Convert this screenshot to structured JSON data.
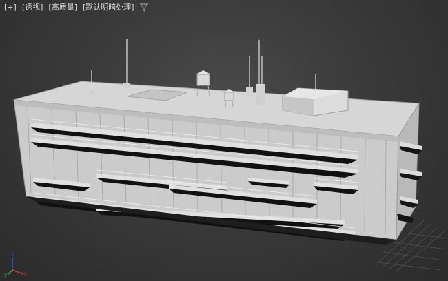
{
  "viewport": {
    "labels": [
      "[+]",
      "[透视]",
      "[高质量]",
      "[默认明暗处理]"
    ]
  },
  "icons": {
    "filter": "filter-funnel-icon",
    "axis": "xyz-axis-gizmo-icon"
  },
  "axis_gizmo": {
    "x_label": "x",
    "y_label": "y",
    "z_label": "z"
  },
  "colors": {
    "background": "#3a3a3a",
    "building_front": "#cfcfcf",
    "building_roof": "#d9d9d9",
    "shadow": "#111111",
    "axis_x": "#e03030",
    "axis_y": "#30c030",
    "axis_z": "#3060e0"
  }
}
